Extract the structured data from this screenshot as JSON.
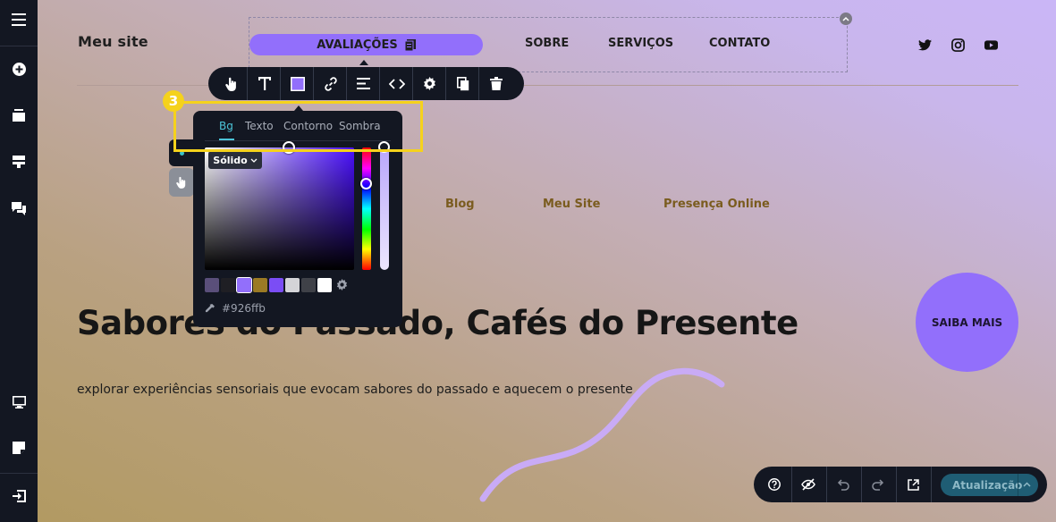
{
  "site": {
    "name": "Meu site",
    "nav": {
      "active_label": "AVALIAÇÕES",
      "items": [
        "SOBRE",
        "SERVIÇOS",
        "CONTATO"
      ]
    },
    "social_icons": [
      "twitter-icon",
      "instagram-icon",
      "youtube-icon"
    ],
    "secondary_links": [
      "Blog",
      "Meu Site",
      "Presença Online"
    ],
    "hero": {
      "title": "Sabores do Passado, Cafés do Presente",
      "text": "explorar experiências sensoriais que evocam sabores do passado e aquecem o presente",
      "cta": "SAIBA MAIS"
    }
  },
  "sidebar": {
    "icons": [
      "menu-icon",
      "add-icon",
      "pages-icon",
      "sections-icon",
      "chat-icon",
      "desktop-preview-icon",
      "notes-icon",
      "exit-icon"
    ]
  },
  "toolbar": {
    "icons": [
      "hand-icon",
      "text-icon",
      "color-icon",
      "link-icon",
      "align-icon",
      "code-icon",
      "settings-icon",
      "duplicate-icon",
      "delete-icon"
    ]
  },
  "color_picker": {
    "tabs": [
      "Bg",
      "Texto",
      "Contorno",
      "Sombra"
    ],
    "active_tab": "Bg",
    "mode": "Sólido",
    "hex": "#926ffb",
    "swatches": [
      "#5a4f7a",
      "#1f1f24",
      "#926ffb",
      "#9b7a24",
      "#7b4df5",
      "#d4d4d8",
      "#3f4148",
      "#ffffff"
    ],
    "selected_swatch": 2
  },
  "annotation": {
    "badge": "3",
    "color": "#f5d21c"
  },
  "bottom_bar": {
    "icons": [
      "help-icon",
      "hide-icon",
      "undo-icon",
      "redo-icon",
      "external-link-icon"
    ],
    "update_label": "Atualização"
  },
  "colors": {
    "accent": "#926ffb",
    "dark": "#131722",
    "tab_active": "#4cc4d8"
  }
}
